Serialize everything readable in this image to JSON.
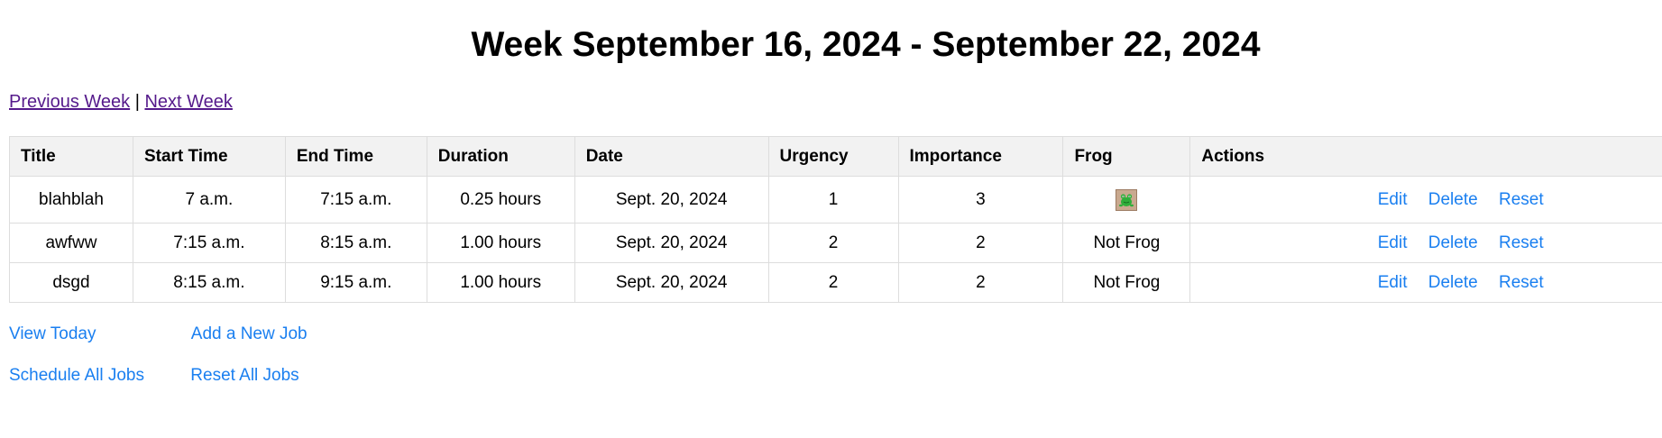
{
  "page": {
    "title": "Week September 16, 2024 - September 22, 2024"
  },
  "week_nav": {
    "previous": "Previous Week",
    "separator": "|",
    "next": "Next Week"
  },
  "table": {
    "headers": [
      "Title",
      "Start Time",
      "End Time",
      "Duration",
      "Date",
      "Urgency",
      "Importance",
      "Frog",
      "Actions"
    ],
    "rows": [
      {
        "title": "blahblah",
        "start": "7 a.m.",
        "end": "7:15 a.m.",
        "duration": "0.25 hours",
        "date": "Sept. 20, 2024",
        "urgency": "1",
        "importance": "3",
        "frog": "",
        "frog_icon": "frog-icon"
      },
      {
        "title": "awfww",
        "start": "7:15 a.m.",
        "end": "8:15 a.m.",
        "duration": "1.00 hours",
        "date": "Sept. 20, 2024",
        "urgency": "2",
        "importance": "2",
        "frog": "Not Frog"
      },
      {
        "title": "dsgd",
        "start": "8:15 a.m.",
        "end": "9:15 a.m.",
        "duration": "1.00 hours",
        "date": "Sept. 20, 2024",
        "urgency": "2",
        "importance": "2",
        "frog": "Not Frog"
      }
    ],
    "actions": {
      "edit": "Edit",
      "delete": "Delete",
      "reset": "Reset"
    }
  },
  "links": {
    "view_today": "View Today",
    "add_job": "Add a New Job",
    "schedule_all": "Schedule All Jobs",
    "reset_all": "Reset All Jobs"
  },
  "colors": {
    "link": "#1a7ff0",
    "visited": "#551a8b",
    "header_bg": "#f2f2f2",
    "border": "#dddddd"
  }
}
